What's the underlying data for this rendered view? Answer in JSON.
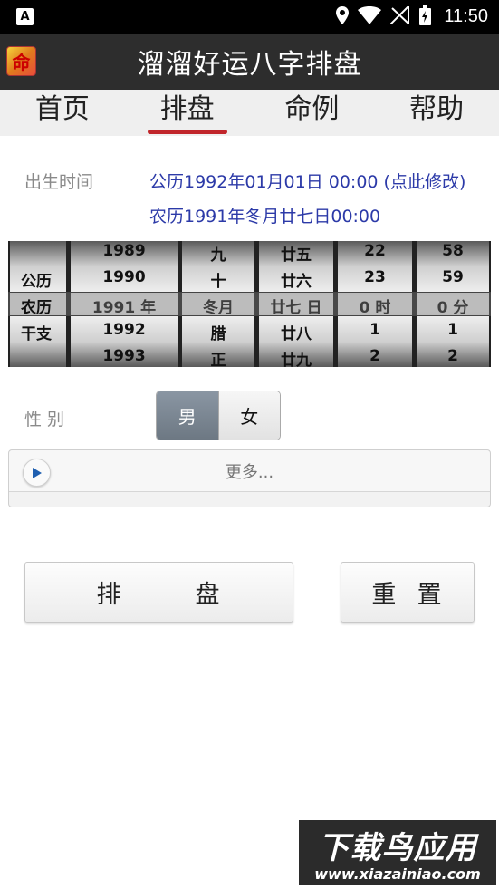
{
  "status_bar": {
    "left_icon": "A",
    "time": "11:50",
    "icons": [
      "location-icon",
      "wifi-icon",
      "no-signal-icon",
      "battery-charging-icon"
    ]
  },
  "app": {
    "title": "溜溜好运八字排盘",
    "logo_glyph": "命"
  },
  "tabs": [
    {
      "label": "首页",
      "active": false
    },
    {
      "label": "排盘",
      "active": true
    },
    {
      "label": "命例",
      "active": false
    },
    {
      "label": "帮助",
      "active": false
    }
  ],
  "birth": {
    "label": "出生时间",
    "solar": "公历1992年01月01日 00:00 (点此修改)",
    "lunar": "农历1991年冬月廿七日00:00"
  },
  "picker": {
    "row_labels": [
      "公历",
      "农历",
      "干支"
    ],
    "columns": [
      {
        "name": "year",
        "values": [
          "1989",
          "1990",
          "1991 年",
          "1992",
          "1993"
        ]
      },
      {
        "name": "month",
        "values": [
          "九",
          "十",
          "冬月",
          "腊",
          "正"
        ]
      },
      {
        "name": "day",
        "values": [
          "廿五",
          "廿六",
          "廿七 日",
          "廿八",
          "廿九"
        ]
      },
      {
        "name": "hour",
        "values": [
          "22",
          "23",
          "0 时",
          "1",
          "2"
        ]
      },
      {
        "name": "minute",
        "values": [
          "58",
          "59",
          "0 分",
          "1",
          "2"
        ]
      }
    ]
  },
  "gender": {
    "label": "性 别",
    "male": "男",
    "female": "女",
    "selected": "男"
  },
  "more": {
    "label": "更多..."
  },
  "actions": {
    "paipan_left": "排",
    "paipan_right": "盘",
    "reset": "重  置"
  },
  "watermark": {
    "big": "下载鸟应用",
    "small": "www.xiazainiao.com"
  }
}
